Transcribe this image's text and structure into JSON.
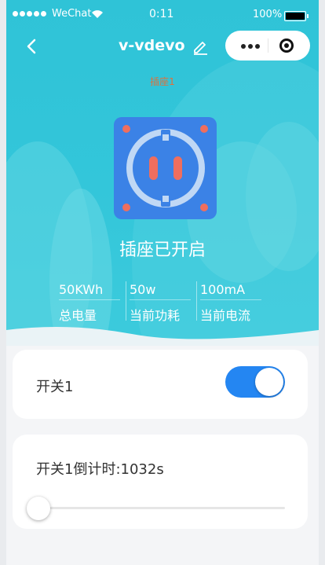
{
  "status_bar": {
    "carrier": "WeChat",
    "time": "0:11",
    "battery": "100%"
  },
  "nav": {
    "title": "v-vdevo"
  },
  "device": {
    "subtitle": "插座1",
    "state": "插座已开启",
    "stats": [
      {
        "value": "50KWh",
        "label": "总电量"
      },
      {
        "value": "50w",
        "label": "当前功耗"
      },
      {
        "value": "100mA",
        "label": "当前电流"
      }
    ]
  },
  "switch_card": {
    "label": "开关1",
    "on": true
  },
  "timer_card": {
    "label": "开关1倒计时:1032s",
    "slider_fraction": 0.0
  },
  "colors": {
    "hero": "#33c6da",
    "accent": "#2486f2",
    "socket": "#3b82e6",
    "subtitle": "#e0703a"
  },
  "icons": [
    "back-arrow-icon",
    "pencil-icon",
    "more-dots-icon",
    "target-icon",
    "socket-icon"
  ]
}
